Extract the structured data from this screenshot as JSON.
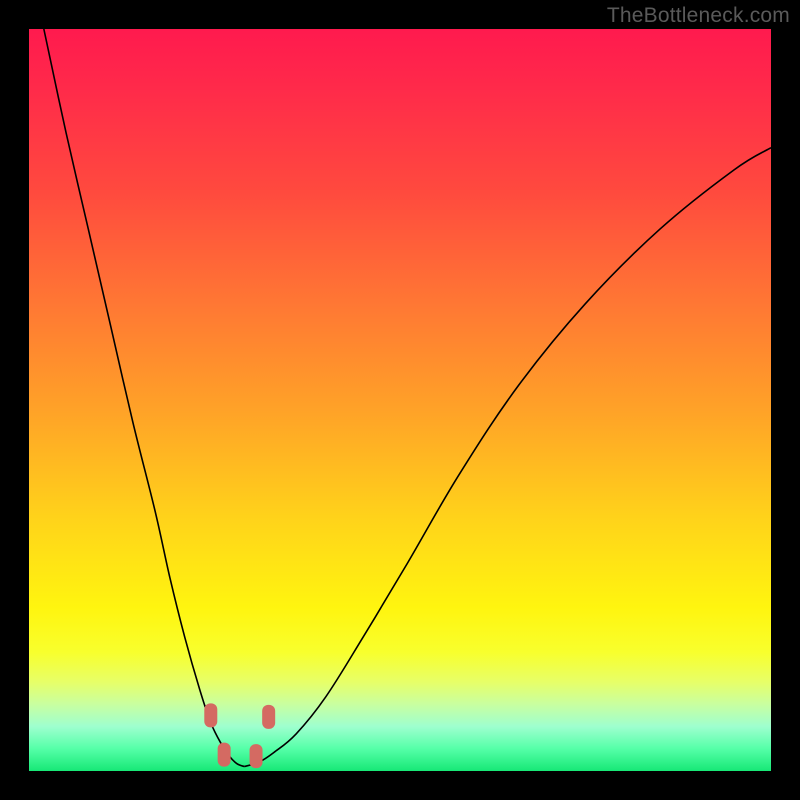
{
  "watermark": "TheBottleneck.com",
  "colors": {
    "frame": "#000000",
    "gradient_top": "#ff1a4e",
    "gradient_bottom": "#17e876",
    "curve": "#000000",
    "nubs": "#d46a62"
  },
  "chart_data": {
    "type": "line",
    "title": "",
    "xlabel": "",
    "ylabel": "",
    "xlim": [
      0,
      100
    ],
    "ylim": [
      0,
      100
    ],
    "grid": false,
    "legend": false,
    "series": [
      {
        "name": "left-branch",
        "x": [
          2,
          5,
          8,
          11,
          14,
          17,
          19,
          21,
          23,
          24.5,
          26,
          27,
          28,
          29
        ],
        "y": [
          100,
          86,
          73,
          60,
          47,
          35,
          26,
          18,
          11,
          6.5,
          3.5,
          2,
          1,
          0.6
        ]
      },
      {
        "name": "right-branch",
        "x": [
          29,
          31,
          33,
          36,
          40,
          45,
          51,
          58,
          66,
          75,
          85,
          95,
          100
        ],
        "y": [
          0.6,
          1.2,
          2.5,
          5,
          10,
          18,
          28,
          40,
          52,
          63,
          73,
          81,
          84
        ]
      }
    ],
    "annotations": [
      {
        "name": "nub-left-upper",
        "x": 24.5,
        "y": 7.5
      },
      {
        "name": "nub-left-lower",
        "x": 26.3,
        "y": 2.2
      },
      {
        "name": "nub-right-lower",
        "x": 30.6,
        "y": 2.0
      },
      {
        "name": "nub-right-upper",
        "x": 32.3,
        "y": 7.3
      }
    ],
    "note": "Axes are unlabeled in the source image; x and y are normalized 0–100 against the gradient plot area. y=0 at the green bottom edge, y=100 at the red top edge."
  }
}
